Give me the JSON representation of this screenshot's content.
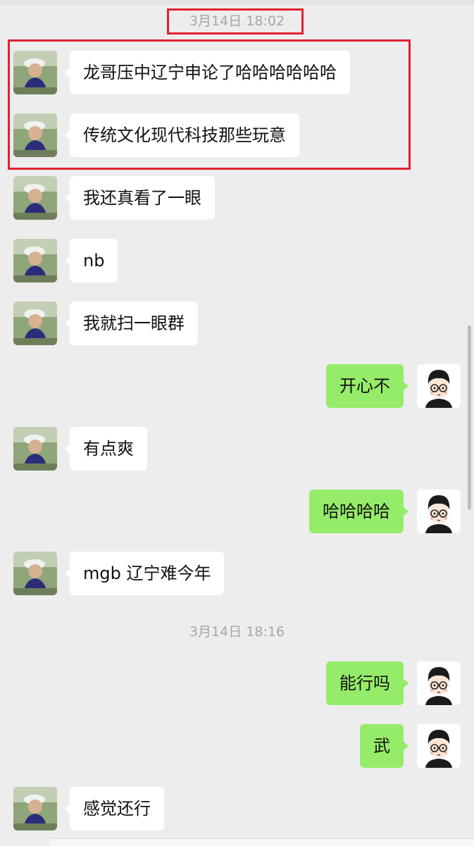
{
  "chat": {
    "timestamps": [
      "3月14日 18:02",
      "3月14日 18:16"
    ],
    "messages": [
      {
        "side": "left",
        "text": "龙哥压中辽宁申论了哈哈哈哈哈哈"
      },
      {
        "side": "left",
        "text": "传统文化现代科技那些玩意"
      },
      {
        "side": "left",
        "text": "我还真看了一眼"
      },
      {
        "side": "left",
        "text": "nb"
      },
      {
        "side": "left",
        "text": "我就扫一眼群"
      },
      {
        "side": "right",
        "text": "开心不"
      },
      {
        "side": "left",
        "text": "有点爽"
      },
      {
        "side": "right",
        "text": "哈哈哈哈"
      },
      {
        "side": "left",
        "text": "mgb 辽宁难今年"
      },
      {
        "side": "right",
        "text": "能行吗"
      },
      {
        "side": "right",
        "text": "武"
      },
      {
        "side": "left",
        "text": "感觉还行"
      }
    ]
  },
  "colors": {
    "background": "#ededed",
    "incoming_bubble": "#ffffff",
    "outgoing_bubble": "#95ec69",
    "highlight_box": "#e0212e",
    "timestamp_text": "#a6a6a6"
  },
  "icons": {
    "contact_avatar": "photo-avatar-icon",
    "self_avatar": "cartoon-glasses-avatar-icon"
  }
}
